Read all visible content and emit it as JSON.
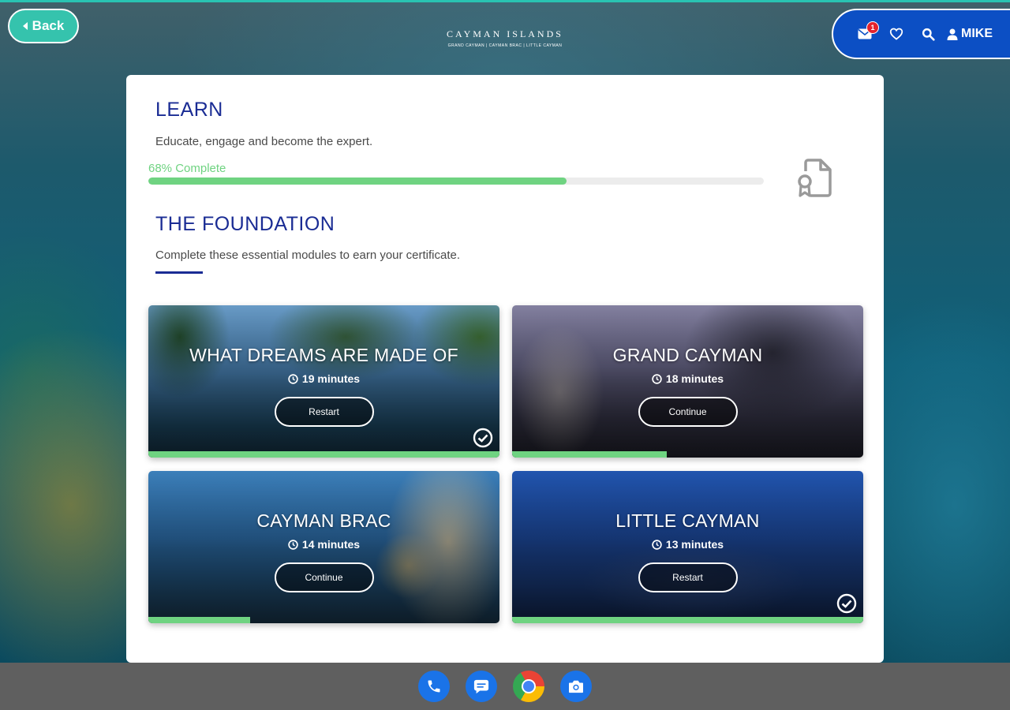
{
  "header": {
    "back_label": "Back",
    "logo_main": "CAYMAN ISLANDS",
    "logo_sub": "GRAND CAYMAN | CAYMAN BRAC | LITTLE CAYMAN",
    "notification_count": "1",
    "user_name": "MIKE",
    "nav_icons": [
      "mail-icon",
      "heart-icon",
      "search-icon",
      "user-icon"
    ]
  },
  "learn": {
    "title": "LEARN",
    "subtitle": "Educate, engage and become the expert.",
    "progress_label": "68% Complete",
    "progress_percent": 68
  },
  "foundation": {
    "title": "THE FOUNDATION",
    "subtitle": "Complete these essential modules to earn your certificate."
  },
  "modules": [
    {
      "title": "WHAT DREAMS ARE MADE OF",
      "duration": "19 minutes",
      "action": "Restart",
      "completed": true,
      "progress_percent": 100
    },
    {
      "title": "GRAND CAYMAN",
      "duration": "18 minutes",
      "action": "Continue",
      "completed": false,
      "progress_percent": 44
    },
    {
      "title": "CAYMAN BRAC",
      "duration": "14 minutes",
      "action": "Continue",
      "completed": false,
      "progress_percent": 29
    },
    {
      "title": "LITTLE CAYMAN",
      "duration": "13 minutes",
      "action": "Restart",
      "completed": true,
      "progress_percent": 100
    }
  ],
  "taskbar": {
    "apps": [
      "phone-app-icon",
      "messages-app-icon",
      "chrome-app-icon",
      "camera-app-icon"
    ]
  },
  "colors": {
    "accent_teal": "#35c3ad",
    "nav_blue": "#0c4fc4",
    "heading_blue": "#1a2c94",
    "progress_green": "#6fd381"
  }
}
